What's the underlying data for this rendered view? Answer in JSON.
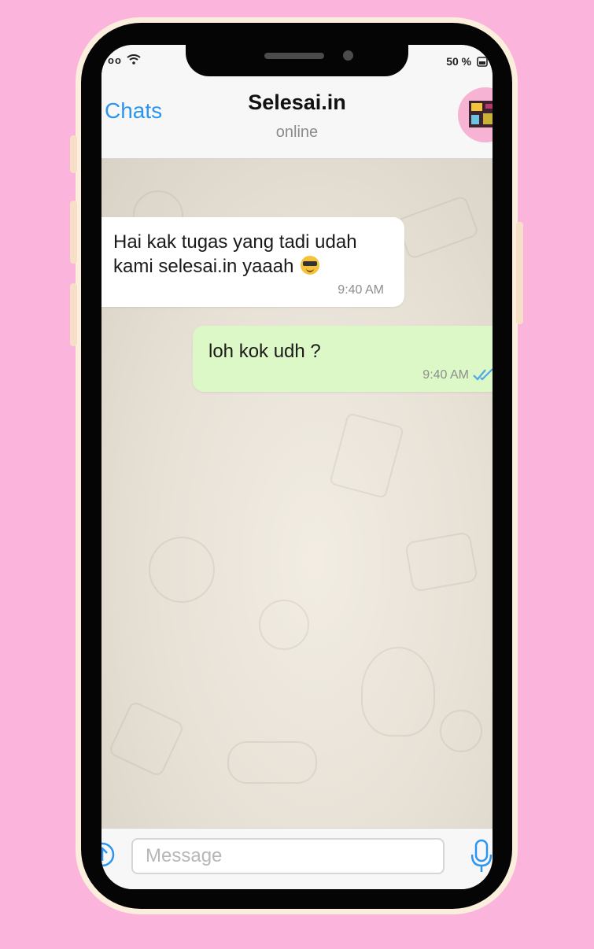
{
  "status_bar": {
    "signal": "oo",
    "battery": "50 %"
  },
  "header": {
    "back_label": "Chats",
    "title": "Selesai.in",
    "status": "online"
  },
  "messages": [
    {
      "direction": "incoming",
      "text": "Hai kak tugas yang tadi udah kami selesai.in yaaah",
      "emoji": "sunglasses-emoji",
      "time": "9:40 AM"
    },
    {
      "direction": "outgoing",
      "text": "loh kok udh ?",
      "time": "9:40 AM",
      "read_receipt": "double-check-icon"
    }
  ],
  "input": {
    "placeholder": "Message"
  },
  "colors": {
    "background": "#fbb5dd",
    "accent": "#2b95f0",
    "outgoing_bubble": "#dcf8c6",
    "read_check": "#4fa6e8"
  }
}
